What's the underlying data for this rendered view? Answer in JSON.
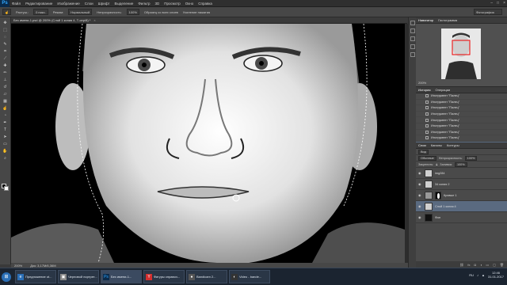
{
  "menubar": {
    "logo": "Ps",
    "items": [
      "Файл",
      "Редактирование",
      "Изображение",
      "Слои",
      "Шрифт",
      "Выделение",
      "Фильтр",
      "3D",
      "Просмотр",
      "Окно",
      "Справка"
    ],
    "controls": [
      "–",
      "□",
      "×"
    ]
  },
  "options": {
    "feather_label": "Растуш.:",
    "feather_value": "0 пикс.",
    "mode_label": "Режим:",
    "mode_value": "Нормальный",
    "opacity_label": "Непрозрачность:",
    "opacity_value": "100%",
    "sample_all": "Образец со всех слоев",
    "protect": "Усиление нажатия",
    "workspace": "Фотография"
  },
  "document": {
    "tab_title": "Без имени-1.psd @ 200% (Слой 1 копия 4, Т-сер/8) *",
    "zoom": "200%",
    "doc_size": "Док: 3,17М/6,36М"
  },
  "navigator": {
    "tabs": [
      "Навигатор",
      "Гистограмма"
    ],
    "zoom": "200%"
  },
  "history": {
    "tabs": [
      "История",
      "Операции"
    ],
    "items": [
      "Инструмент \"Палец\"",
      "Инструмент \"Палец\"",
      "Инструмент \"Палец\"",
      "Инструмент \"Палец\"",
      "Инструмент \"Палец\"",
      "Инструмент \"Палец\"",
      "Инструмент \"Палец\"",
      "Инструмент \"Палец\"",
      "Инструмент \"Палец\""
    ],
    "selected_index": 8
  },
  "layers": {
    "tabs": [
      "Слои",
      "Каналы",
      "Контуры"
    ],
    "kind_label": "Вид",
    "blend_mode": "Обычные",
    "opacity_label": "Непрозрачность:",
    "opacity_value": "100%",
    "lock_label": "Закрепить:",
    "fill_label": "Заливка:",
    "fill_value": "100%",
    "items": [
      {
        "name": "img284",
        "thumb": "face"
      },
      {
        "name": "34 копия 2",
        "thumb": "face"
      },
      {
        "name": "Кривые 1",
        "thumb": "adj",
        "has_mask": true
      },
      {
        "name": "Слой 1 копия 4",
        "thumb": "face",
        "selected": true
      },
      {
        "name": "Фон",
        "thumb": "dark"
      }
    ]
  },
  "taskbar": {
    "start": "⊞",
    "tasks": [
      {
        "label": "Предложение ot...",
        "icon": "e",
        "color": "#2b6fb6"
      },
      {
        "label": "Черновой портрет...",
        "icon": "▣",
        "color": "#888"
      },
      {
        "label": "Без имени-1...",
        "icon": "Ps",
        "color": "#0b2a4a",
        "active": true
      },
      {
        "label": "Фигуры справоч...",
        "icon": "Y",
        "color": "#d32f2f"
      },
      {
        "label": "Bandicam 2...",
        "icon": "●",
        "color": "#555"
      },
      {
        "label": "Video - bande...",
        "icon": "◐",
        "color": "#333"
      }
    ],
    "lang": "RU",
    "time": "12:46",
    "date": "31.01.2017"
  },
  "colors": {
    "accent_selection": "#5a6a80",
    "ps_blue": "#31a8ff"
  }
}
